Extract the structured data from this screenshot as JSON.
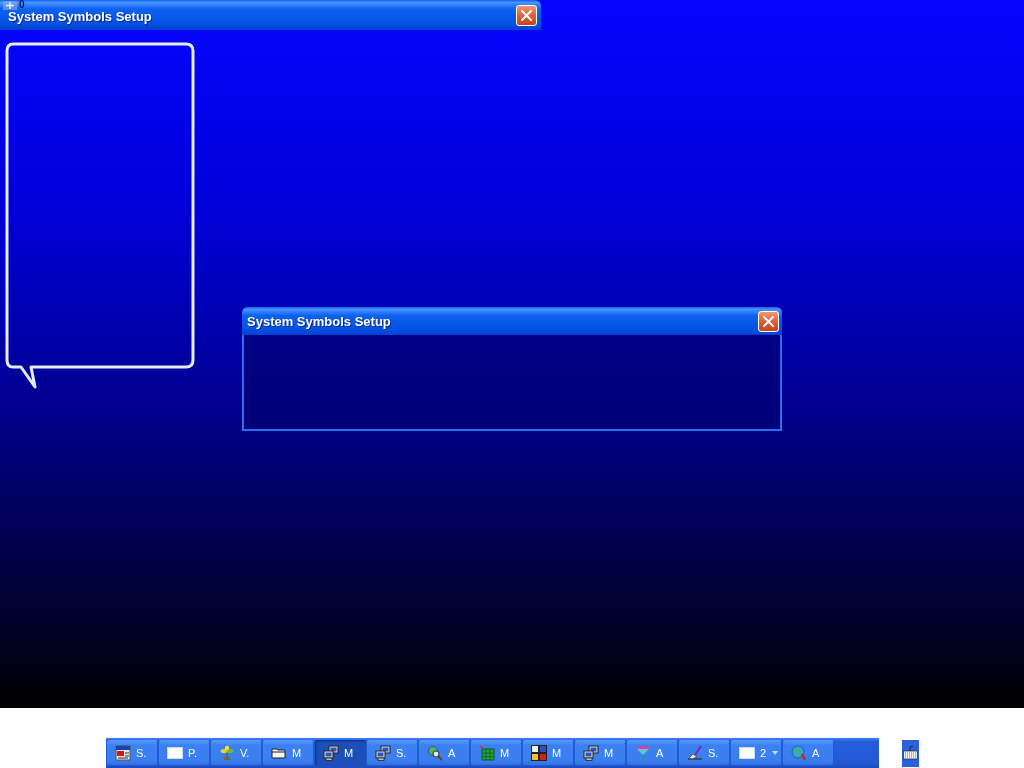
{
  "top_window": {
    "title": "System Symbols Setup",
    "corner_label": "0"
  },
  "dialog": {
    "title": "System Symbols Setup"
  },
  "taskbar": {
    "buttons": [
      {
        "label": "S.",
        "kind": "single",
        "selected": false
      },
      {
        "label": "P.",
        "kind": "single",
        "selected": false
      },
      {
        "label": "V.",
        "kind": "single",
        "selected": false
      },
      {
        "label": "M",
        "kind": "single",
        "selected": false
      },
      {
        "label": "M",
        "kind": "single",
        "selected": true
      },
      {
        "label": "S.",
        "kind": "single",
        "selected": false
      },
      {
        "label": "A",
        "kind": "single",
        "selected": false
      },
      {
        "label": "M",
        "kind": "single",
        "selected": false
      },
      {
        "label": "M",
        "kind": "single",
        "selected": false
      },
      {
        "label": "M",
        "kind": "single",
        "selected": false
      },
      {
        "label": "A",
        "kind": "single",
        "selected": false
      },
      {
        "label": "S.",
        "kind": "single",
        "selected": false
      },
      {
        "label": "2",
        "kind": "group",
        "selected": false
      },
      {
        "label": "A",
        "kind": "single",
        "selected": false
      }
    ]
  }
}
